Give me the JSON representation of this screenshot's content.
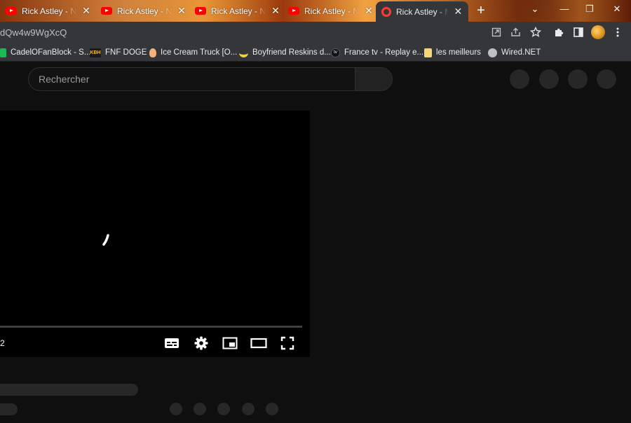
{
  "tabs": [
    {
      "title": "Rick Astley - Never Gonna Give You Up",
      "favicon": "youtube-icon",
      "active": false
    },
    {
      "title": "Rick Astley - Never Gonna Give You Up",
      "favicon": "youtube-icon",
      "active": false
    },
    {
      "title": "Rick Astley - Never Gonna Give You Up",
      "favicon": "youtube-icon",
      "active": false
    },
    {
      "title": "Rick Astley - Never Gonna Give You Up",
      "favicon": "youtube-icon",
      "active": false
    },
    {
      "title": "Rick Astley - Never Gonna Give You Up",
      "favicon": "loading-ring-icon",
      "active": true
    }
  ],
  "address_bar": {
    "url": "dQw4w9WgXcQ"
  },
  "bookmarks": [
    {
      "label": "CadelOFanBlock - S...",
      "icon": "green-s-icon"
    },
    {
      "label": "FNF DOGE",
      "icon": "kbh-icon"
    },
    {
      "label": "Ice Cream Truck [O...",
      "icon": "ice-cream-icon"
    },
    {
      "label": "Boyfriend Reskins d...",
      "icon": "banana-icon"
    },
    {
      "label": "France tv - Replay e...",
      "icon": "france-tv-icon"
    },
    {
      "label": "les meilleurs",
      "icon": "folder-icon"
    },
    {
      "label": "Wired.NET",
      "icon": "globe-icon"
    }
  ],
  "search": {
    "placeholder": "Rechercher"
  },
  "player": {
    "time": "2"
  },
  "colors": {
    "page_bg": "#0f0f0f",
    "chrome_bg": "#35363a",
    "skeleton": "#272727",
    "youtube_red": "#ff0000"
  }
}
